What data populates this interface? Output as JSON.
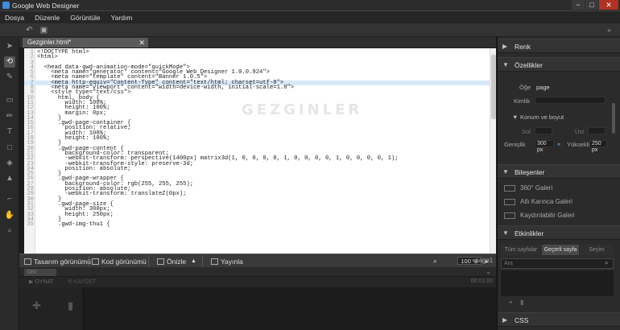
{
  "window": {
    "title": "Google Web Designer",
    "controls": [
      "−",
      "□",
      "✕"
    ]
  },
  "menu": [
    "Dosya",
    "Düzenle",
    "Görüntüle",
    "Yardım"
  ],
  "icons": {
    "toolbar": [
      "undo-icon",
      "save-icon"
    ],
    "expand": "»"
  },
  "document_tab": {
    "name": "Gezginler.html*",
    "close": "✕"
  },
  "code_lines": [
    {
      "n": "1",
      "t": "<!DOCTYPE html>"
    },
    {
      "n": "2",
      "t": "<html>"
    },
    {
      "n": "3",
      "t": ""
    },
    {
      "n": "4",
      "t": "  <head data-gwd-animation-mode=\"quickMode\">"
    },
    {
      "n": "5",
      "t": "    <meta name=\"generator\" content=\"Google Web Designer 1.0.0.924\">"
    },
    {
      "n": "6",
      "t": "    <meta name=\"template\" content=\"Banner 1.0.5\">"
    },
    {
      "n": "7",
      "t": "    <meta http-equiv=\"Content-Type\" content=\"text/html; charset=utf-8\">"
    },
    {
      "n": "8",
      "t": "    <meta name=\"viewport\" content=\"width=device-width, initial-scale=1.0\">"
    },
    {
      "n": "9",
      "t": "    <style type=\"text/css\">"
    },
    {
      "n": "10",
      "t": "      html, body {"
    },
    {
      "n": "11",
      "t": "        width: 100%;"
    },
    {
      "n": "12",
      "t": "        height: 100%;"
    },
    {
      "n": "13",
      "t": "        margin: 0px;"
    },
    {
      "n": "14",
      "t": "      }"
    },
    {
      "n": "15",
      "t": "      .gwd-page-container {"
    },
    {
      "n": "16",
      "t": "        position: relative;"
    },
    {
      "n": "17",
      "t": "        width: 100%;"
    },
    {
      "n": "18",
      "t": "        height: 100%;"
    },
    {
      "n": "19",
      "t": "      }"
    },
    {
      "n": "20",
      "t": "      .gwd-page-content {"
    },
    {
      "n": "21",
      "t": "        background-color: transparent;"
    },
    {
      "n": "22",
      "t": "        -webkit-transform: perspective(1400px) matrix3d(1, 0, 0, 0, 0, 1, 0, 0, 0, 0, 1, 0, 0, 0, 0, 1);"
    },
    {
      "n": "23",
      "t": "        -webkit-transform-style: preserve-3d;"
    },
    {
      "n": "24",
      "t": "        position: absolute;"
    },
    {
      "n": "25",
      "t": "      }"
    },
    {
      "n": "26",
      "t": "      .gwd-page-wrapper {"
    },
    {
      "n": "27",
      "t": "        background-color: rgb(255, 255, 255);"
    },
    {
      "n": "28",
      "t": "        position: absolute;"
    },
    {
      "n": "29",
      "t": "        -webkit-transform: translateZ(0px);"
    },
    {
      "n": "30",
      "t": "      }"
    },
    {
      "n": "31",
      "t": "      .gwd-page-size {"
    },
    {
      "n": "32",
      "t": "        width: 300px;"
    },
    {
      "n": "33",
      "t": "        height: 250px;"
    },
    {
      "n": "34",
      "t": "      }"
    },
    {
      "n": "35",
      "t": "      .gwd-img-thu1 {"
    }
  ],
  "highlight_line": "7",
  "watermark": "GEZGINLER",
  "viewbar": {
    "design_view": "Tasarım görünümü",
    "code_view": "Kod görünümü",
    "preview": "Önizle",
    "publish": "Yayınla",
    "zoom": "100 %",
    "page": "page1"
  },
  "timeline": {
    "tab": "DIV",
    "play": "OYNAT",
    "record": "KAYDET",
    "time": "00:01.00"
  },
  "panel": {
    "renk": "Renk",
    "ozellikler": "Özellikler",
    "oge_label": "Öğe",
    "oge_value": "page",
    "kimlik_label": "Kimlik",
    "konum": "Konum ve boyut",
    "sol": "Sol",
    "ust": "Üst",
    "genislik": "Genişlik",
    "yukseklik": "Yükseklik",
    "width_val": "300 px",
    "height_val": "250 px",
    "bilesenler": "Bileşenler",
    "comp1": "360° Galeri",
    "comp2": "Atlı Karınca Galeri",
    "comp3": "Kaydırılabilir Galeri",
    "etkinlikler": "Etkinlikler",
    "tab1": "Tüm sayfalar",
    "tab2": "Geçerli sayfa",
    "tab3": "Seçim",
    "search_ph": "Ara",
    "css": "CSS"
  }
}
